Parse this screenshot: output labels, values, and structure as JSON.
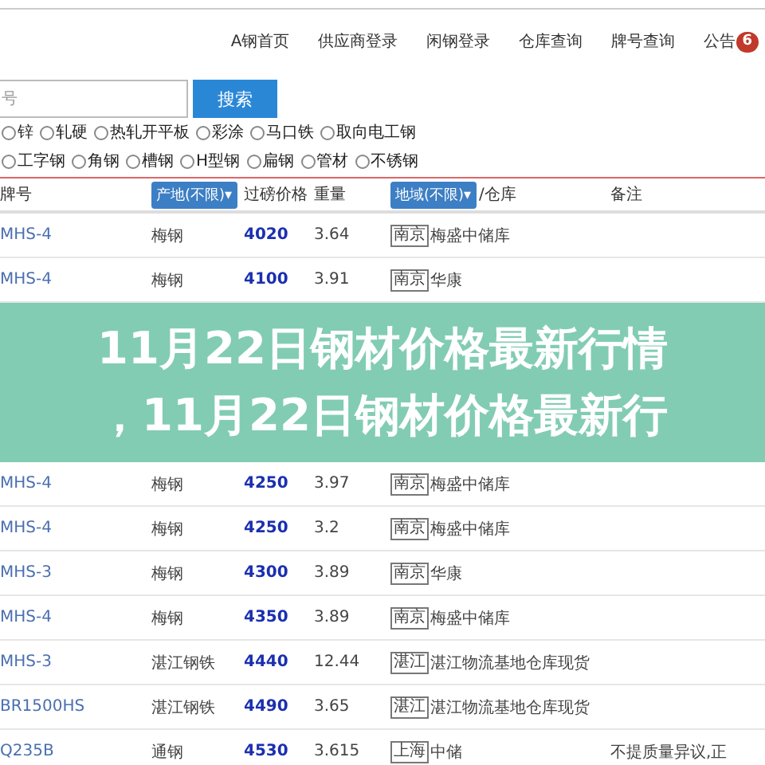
{
  "nav": {
    "links": [
      "A钢首页",
      "供应商登录",
      "闲钢登录",
      "仓库查询",
      "牌号查询"
    ],
    "notice": {
      "label": "公告",
      "badge": "6"
    }
  },
  "search": {
    "placeholder": "号",
    "button": "搜索"
  },
  "filters": [
    [
      {
        "label": "锌",
        "selected": false
      },
      {
        "label": "轧硬",
        "selected": false
      },
      {
        "label": "热轧开平板",
        "selected": false
      },
      {
        "label": "彩涂",
        "selected": false
      },
      {
        "label": "马口铁",
        "selected": false
      },
      {
        "label": "取向电工钢",
        "selected": false
      }
    ],
    [
      {
        "label": "工字钢",
        "selected": false
      },
      {
        "label": "角钢",
        "selected": false
      },
      {
        "label": "槽钢",
        "selected": false
      },
      {
        "label": "H型钢",
        "selected": false
      },
      {
        "label": "扁钢",
        "selected": false
      },
      {
        "label": "管材",
        "selected": false
      },
      {
        "label": "不锈钢",
        "selected": false
      }
    ]
  ],
  "table": {
    "columns": {
      "brand": "牌号",
      "origin": "产地(不限)▾",
      "price": "过磅价格",
      "weight": "重量",
      "region": "地域(不限)▾",
      "warehouse": "/仓库",
      "remark": "备注"
    },
    "rows_before": [
      {
        "brand": "MHS-4",
        "origin": "梅钢",
        "price": "4020",
        "weight": "3.64",
        "region": "南京",
        "warehouse": "梅盛中储库"
      },
      {
        "brand": "MHS-4",
        "origin": "梅钢",
        "price": "4100",
        "weight": "3.91",
        "region": "南京",
        "warehouse": "华康"
      }
    ],
    "rows_after": [
      {
        "brand": "MHS-4",
        "origin": "梅钢",
        "price": "4250",
        "weight": "3.97",
        "region": "南京",
        "warehouse": "梅盛中储库"
      },
      {
        "brand": "MHS-4",
        "origin": "梅钢",
        "price": "4250",
        "weight": "3.2",
        "region": "南京",
        "warehouse": "梅盛中储库"
      },
      {
        "brand": "MHS-3",
        "origin": "梅钢",
        "price": "4300",
        "weight": "3.89",
        "region": "南京",
        "warehouse": "华康"
      },
      {
        "brand": "MHS-4",
        "origin": "梅钢",
        "price": "4350",
        "weight": "3.89",
        "region": "南京",
        "warehouse": "梅盛中储库"
      },
      {
        "brand": "MHS-3",
        "origin": "湛江钢铁",
        "price": "4440",
        "weight": "12.44",
        "region": "湛江",
        "warehouse": "湛江物流基地仓库现货"
      },
      {
        "brand": "BR1500HS",
        "origin": "湛江钢铁",
        "price": "4490",
        "weight": "3.65",
        "region": "湛江",
        "warehouse": "湛江物流基地仓库现货"
      },
      {
        "brand": "Q235B",
        "origin": "通钢",
        "price": "4530",
        "weight": "3.615",
        "region": "上海",
        "warehouse": "中储",
        "remark": "不提质量异议,正"
      }
    ]
  },
  "banner": {
    "lines": [
      "11月22日钢材价格最新行情",
      "，11月22日钢材价格最新行"
    ]
  }
}
